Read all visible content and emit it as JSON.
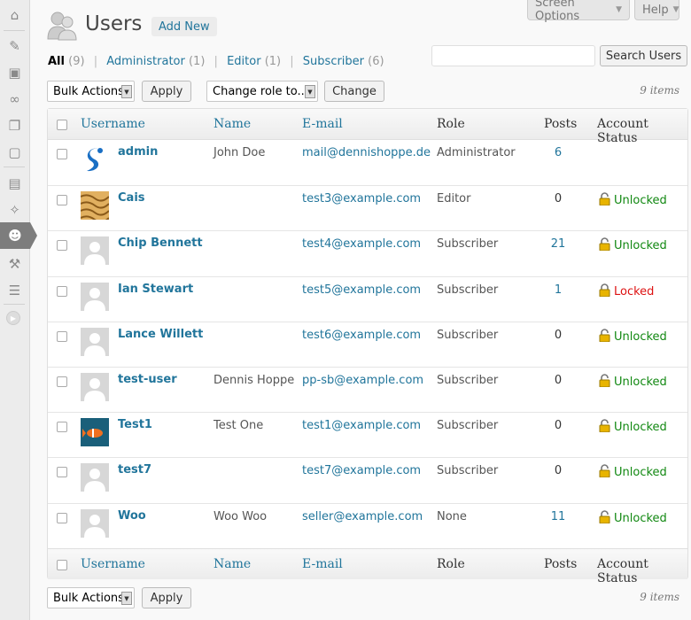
{
  "top_tabs": {
    "screen_options": "Screen Options",
    "help": "Help"
  },
  "header": {
    "title": "Users",
    "add_new": "Add New"
  },
  "filters": [
    {
      "label": "All",
      "count": "(9)",
      "current": true
    },
    {
      "label": "Administrator",
      "count": "(1)"
    },
    {
      "label": "Editor",
      "count": "(1)"
    },
    {
      "label": "Subscriber",
      "count": "(6)"
    }
  ],
  "search": {
    "placeholder": "",
    "button": "Search Users"
  },
  "top_nav": {
    "bulk_actions": "Bulk Actions",
    "apply": "Apply",
    "change_role": "Change role to...",
    "change": "Change",
    "items": "9 items"
  },
  "bottom_nav": {
    "bulk_actions": "Bulk Actions",
    "apply": "Apply",
    "items": "9 items"
  },
  "columns": {
    "username": "Username",
    "name": "Name",
    "email": "E-mail",
    "role": "Role",
    "posts": "Posts",
    "account_status": "Account Status"
  },
  "colors": {
    "link": "#21759b",
    "unlocked": "#118811",
    "locked": "#dd1111"
  },
  "rows": [
    {
      "username": "admin",
      "name": "John Doe",
      "email": "mail@dennishoppe.de",
      "role": "Administrator",
      "posts": "6",
      "posts_link": true,
      "status": "",
      "avatar": "logo"
    },
    {
      "username": "Cais",
      "name": "",
      "email": "test3@example.com",
      "role": "Editor",
      "posts": "0",
      "posts_link": false,
      "status": "Unlocked",
      "avatar": "tiger"
    },
    {
      "username": "Chip Bennett",
      "name": "",
      "email": "test4@example.com",
      "role": "Subscriber",
      "posts": "21",
      "posts_link": true,
      "status": "Unlocked",
      "avatar": "mystery"
    },
    {
      "username": "Ian Stewart",
      "name": "",
      "email": "test5@example.com",
      "role": "Subscriber",
      "posts": "1",
      "posts_link": true,
      "status": "Locked",
      "avatar": "mystery"
    },
    {
      "username": "Lance Willett",
      "name": "",
      "email": "test6@example.com",
      "role": "Subscriber",
      "posts": "0",
      "posts_link": false,
      "status": "Unlocked",
      "avatar": "mystery"
    },
    {
      "username": "test-user",
      "name": "Dennis Hoppe",
      "email": "pp-sb@example.com",
      "role": "Subscriber",
      "posts": "0",
      "posts_link": false,
      "status": "Unlocked",
      "avatar": "mystery"
    },
    {
      "username": "Test1",
      "name": "Test One",
      "email": "test1@example.com",
      "role": "Subscriber",
      "posts": "0",
      "posts_link": false,
      "status": "Unlocked",
      "avatar": "fish"
    },
    {
      "username": "test7",
      "name": "",
      "email": "test7@example.com",
      "role": "Subscriber",
      "posts": "0",
      "posts_link": false,
      "status": "Unlocked",
      "avatar": "mystery"
    },
    {
      "username": "Woo",
      "name": "Woo Woo",
      "email": "seller@example.com",
      "role": "None",
      "posts": "11",
      "posts_link": true,
      "status": "Unlocked",
      "avatar": "mystery"
    }
  ],
  "sidebar": [
    {
      "icon": "dashboard-icon"
    },
    {
      "icon": "posts-pin-icon"
    },
    {
      "icon": "media-icon"
    },
    {
      "icon": "links-icon"
    },
    {
      "icon": "pages-icon"
    },
    {
      "icon": "comments-icon"
    },
    {
      "icon": "appearance-icon"
    },
    {
      "icon": "plugins-icon"
    },
    {
      "icon": "users-icon"
    },
    {
      "icon": "tools-icon"
    },
    {
      "icon": "settings-icon"
    }
  ]
}
